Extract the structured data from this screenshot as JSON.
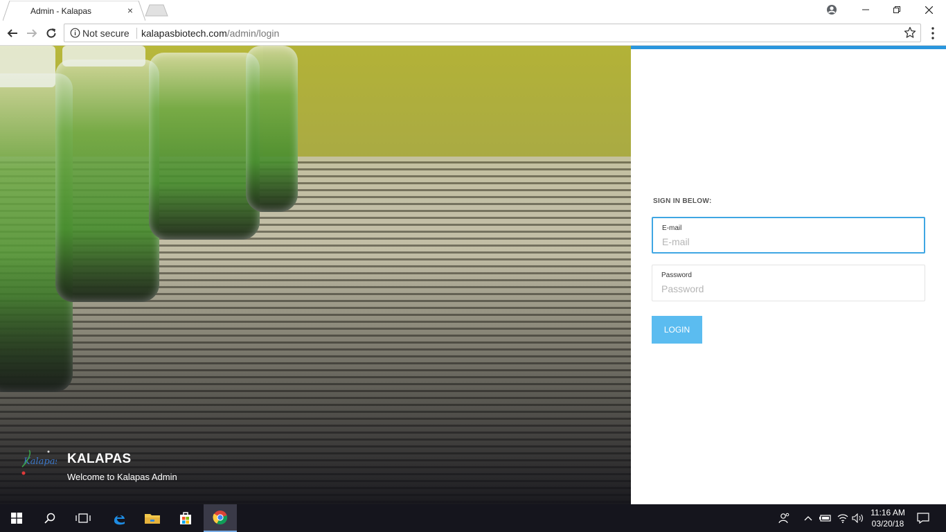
{
  "browser": {
    "tab_title": "Admin - Kalapas",
    "tab_close": "×",
    "security_label": "Not secure",
    "url_host": "kalapasbiotech.com",
    "url_path": "/admin/login"
  },
  "hero": {
    "brand_name": "KALAPAS",
    "tagline": "Welcome to Kalapas Admin",
    "logo_text": "Kalapas"
  },
  "login": {
    "heading": "SIGN IN BELOW:",
    "email_label": "E-mail",
    "email_placeholder": "E-mail",
    "password_label": "Password",
    "password_placeholder": "Password",
    "button_label": "LOGIN",
    "accent_color": "#2b96dd",
    "button_color": "#5bbcf0"
  },
  "taskbar": {
    "time": "11:16 AM",
    "date": "03/20/18",
    "pinned": [
      "start-icon",
      "search-icon",
      "task-view-icon",
      "edge-icon",
      "file-explorer-icon",
      "store-icon",
      "chrome-icon"
    ]
  }
}
